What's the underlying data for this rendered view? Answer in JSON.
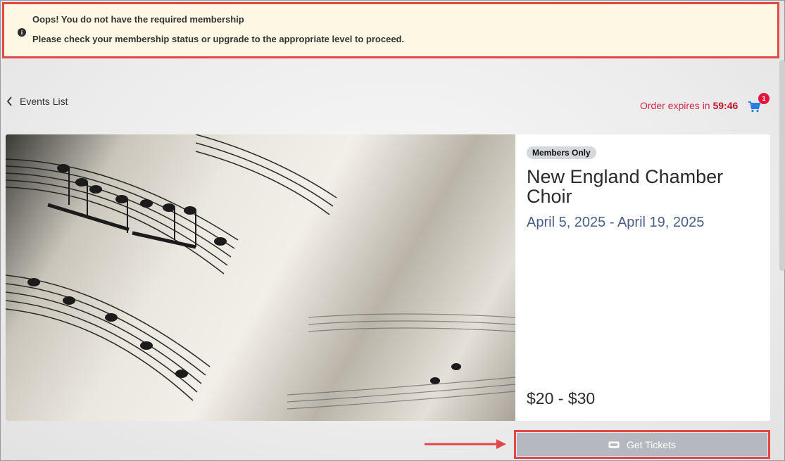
{
  "alert": {
    "icon": "info-icon",
    "title": "Oops! You do not have the required membership",
    "message": "Please check your membership status or upgrade to the appropriate level to proceed."
  },
  "nav": {
    "back_label": "Events List",
    "back_icon": "chevron-left-icon"
  },
  "order": {
    "expiry_label": "Order expires in",
    "expiry_time": "59:46",
    "cart_icon": "cart-icon",
    "cart_count": "1"
  },
  "event": {
    "badge": "Members Only",
    "title": "New England Chamber Choir",
    "dates": "April 5, 2025 - April 19, 2025",
    "price": "$20 - $30",
    "image": "sheet-music-image"
  },
  "actions": {
    "get_tickets_label": "Get Tickets",
    "ticket_icon": "ticket-icon"
  },
  "colors": {
    "alert_bg": "#fdf7e4",
    "highlight": "#e04848",
    "expiry": "#c8102e",
    "dates": "#4a5f86",
    "button_disabled": "#b5b9bf"
  }
}
